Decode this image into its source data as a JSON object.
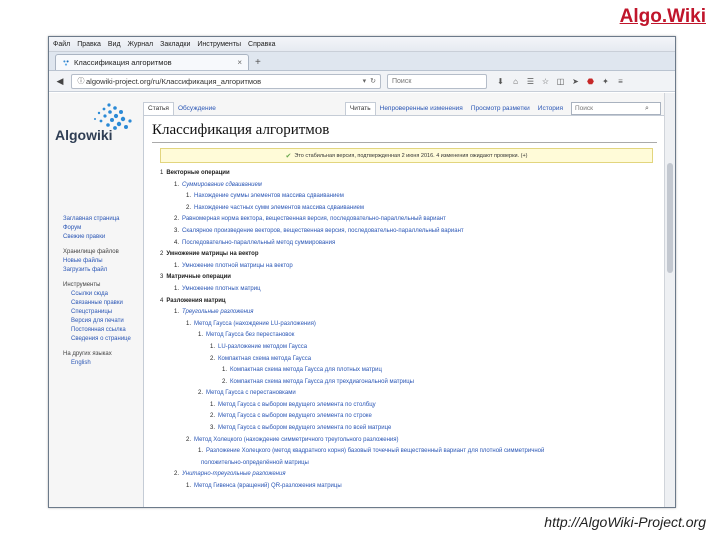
{
  "slide": {
    "title": "Algo.Wiki",
    "footer": "http://AlgoWiki-Project.org"
  },
  "browser": {
    "menu": [
      "Файл",
      "Правка",
      "Вид",
      "Журнал",
      "Закладки",
      "Инструменты",
      "Справка"
    ],
    "tab_title": "Классификация алгоритмов",
    "tab_close": "×",
    "new_tab": "+",
    "url": "algowiki-project.org/ru/Классификация_алгоритмов",
    "search_placeholder": "Поиск",
    "nav_icons": [
      "back-arrow-icon",
      "info-icon"
    ],
    "toolbar_icons": [
      "download-icon",
      "home-icon",
      "bookmarks-icon",
      "star-icon",
      "pocket-icon",
      "send-icon",
      "abp-icon",
      "extension-icon",
      "menu-icon"
    ]
  },
  "wiki": {
    "logo_text": "Algowiki",
    "page_tabs_left": [
      "Статья",
      "Обсуждение"
    ],
    "page_tabs_right": [
      "Читать",
      "Непроверенные изменения",
      "Просмотр разметки",
      "История"
    ],
    "search_placeholder": "Поиск",
    "sidebar": [
      {
        "type": "link",
        "label": "Заглавная страница"
      },
      {
        "type": "link",
        "label": "Форум"
      },
      {
        "type": "link",
        "label": "Свежие правки"
      },
      {
        "type": "head",
        "label": "Хранилище файлов"
      },
      {
        "type": "link",
        "label": "Новые файлы"
      },
      {
        "type": "link",
        "label": "Загрузить файл"
      },
      {
        "type": "head",
        "label": "Инструменты"
      },
      {
        "type": "sub",
        "label": "Ссылки сюда"
      },
      {
        "type": "sub",
        "label": "Связанные правки"
      },
      {
        "type": "sub",
        "label": "Спецстраницы"
      },
      {
        "type": "sub",
        "label": "Версия для печати"
      },
      {
        "type": "sub",
        "label": "Постоянная ссылка"
      },
      {
        "type": "sub",
        "label": "Сведения о странице"
      },
      {
        "type": "head",
        "label": "На других языках"
      },
      {
        "type": "sub",
        "label": "English"
      }
    ],
    "article_title": "Классификация алгоритмов",
    "flagged_version": "Это стабильная версия, подтвержденная 2 июня 2016. 4 изменения ожидают проверки. (+)",
    "toc": [
      {
        "level": 0,
        "num": "1",
        "text": "Векторные операции"
      },
      {
        "level": 1,
        "num": "1.",
        "text": "Суммирование сдваиванием"
      },
      {
        "level": 2,
        "num": "1.",
        "text": "Нахождение суммы элементов массива сдваиванием"
      },
      {
        "level": 2,
        "num": "2.",
        "text": "Нахождение частных сумм элементов массива сдваиванием"
      },
      {
        "level": 1,
        "num": "2.",
        "text": "Равномерная норма вектора, вещественная версия, последовательно-параллельный вариант"
      },
      {
        "level": 1,
        "num": "3.",
        "text": "Скалярное произведение векторов, вещественная версия, последовательно-параллельный вариант"
      },
      {
        "level": 1,
        "num": "4.",
        "text": "Последовательно-параллельный метод суммирования"
      },
      {
        "level": 0,
        "num": "2",
        "text": "Умножение матрицы на вектор"
      },
      {
        "level": 1,
        "num": "1.",
        "text": "Умножение плотной матрицы на вектор"
      },
      {
        "level": 0,
        "num": "3",
        "text": "Матричные операции"
      },
      {
        "level": 1,
        "num": "1.",
        "text": "Умножение плотных матриц"
      },
      {
        "level": 0,
        "num": "4",
        "text": "Разложения матриц"
      },
      {
        "level": 1,
        "num": "1.",
        "text": "Треугольные разложения"
      },
      {
        "level": 2,
        "num": "1.",
        "text": "Метод Гаусса (нахождение LU-разложения)"
      },
      {
        "level": 3,
        "num": "1.",
        "text": "Метод Гаусса без перестановок"
      },
      {
        "level": 4,
        "num": "1.",
        "text": "LU-разложение методом Гаусса"
      },
      {
        "level": 4,
        "num": "2.",
        "text": "Компактная схема метода Гаусса"
      },
      {
        "level": 5,
        "num": "1.",
        "text": "Компактная схема метода Гаусса для плотных матриц"
      },
      {
        "level": 5,
        "num": "2.",
        "text": "Компактная схема метода Гаусса для трехдиагональной матрицы"
      },
      {
        "level": 3,
        "num": "2.",
        "text": "Метод Гаусса с перестановками"
      },
      {
        "level": 4,
        "num": "1.",
        "text": "Метод Гаусса с выбором ведущего элемента по столбцу"
      },
      {
        "level": 4,
        "num": "2.",
        "text": "Метод Гаусса с выбором ведущего элемента по строке"
      },
      {
        "level": 4,
        "num": "3.",
        "text": "Метод Гаусса с выбором ведущего элемента по всей матрице"
      },
      {
        "level": 2,
        "num": "2.",
        "text": "Метод Холецкого (нахождение симметричного треугольного разложения)"
      },
      {
        "level": 3,
        "num": "1.",
        "text": "Разложение Холецкого (метод квадратного корня) базовый точечный вещественный вариант для плотной симметричной"
      },
      {
        "level": 3,
        "num": "",
        "text": "положительно-определённой матрицы"
      },
      {
        "level": 1,
        "num": "2.",
        "text": "Унитарно-треугольные разложения"
      },
      {
        "level": 2,
        "num": "1.",
        "text": "Метод Гивенса (вращений) QR-разложения матрицы"
      }
    ]
  },
  "colors": {
    "slide_title": "#c0152b",
    "link": "#2a56b5",
    "flag_bg": "#fffbd8"
  }
}
